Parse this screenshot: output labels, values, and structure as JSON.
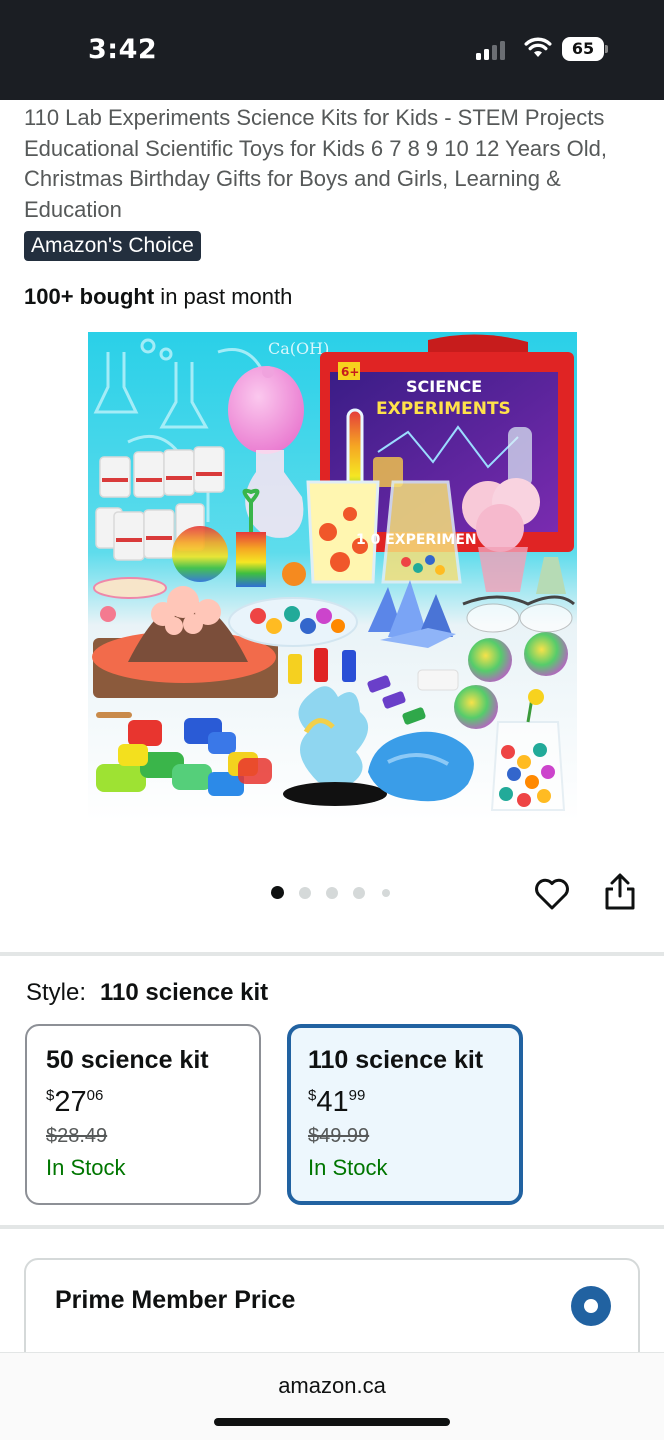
{
  "status_bar": {
    "time": "3:42",
    "battery": "65"
  },
  "product": {
    "title": "110 Lab Experiments Science Kits for Kids - STEM Projects Educational Scientific Toys for Kids 6 7 8 9 10 12 Years Old, Christmas Birthday Gifts for Boys and Girls, Learning & Education",
    "badge": "Amazon's Choice",
    "bought_bold": "100+ bought",
    "bought_rest": " in past month",
    "image": {
      "box_label": "SCIENCE",
      "box_label2": "EXPERIMENTS",
      "age_label": "6+",
      "formula": "Ca(OH)",
      "jar_text": "1 0 EXPERIMEN"
    }
  },
  "carousel": {
    "count": 5,
    "active_index": 0
  },
  "icons": {
    "favorite": "heart-icon",
    "share": "share-icon"
  },
  "style": {
    "label": "Style:",
    "selected": "110 science kit",
    "options": [
      {
        "name": "50 science kit",
        "currency": "$",
        "price_whole": "27",
        "price_cents": "06",
        "list_price": "$28.49",
        "availability": "In Stock"
      },
      {
        "name": "110 science kit",
        "currency": "$",
        "price_whole": "41",
        "price_cents": "99",
        "list_price": "$49.99",
        "availability": "In Stock"
      }
    ]
  },
  "prime": {
    "title": "Prime Member Price"
  },
  "browser": {
    "url": "amazon.ca"
  },
  "colors": {
    "badge_bg": "#232f3e",
    "selected_border": "#2162a1",
    "selected_bg": "#edf7fd",
    "in_stock": "#007600"
  }
}
